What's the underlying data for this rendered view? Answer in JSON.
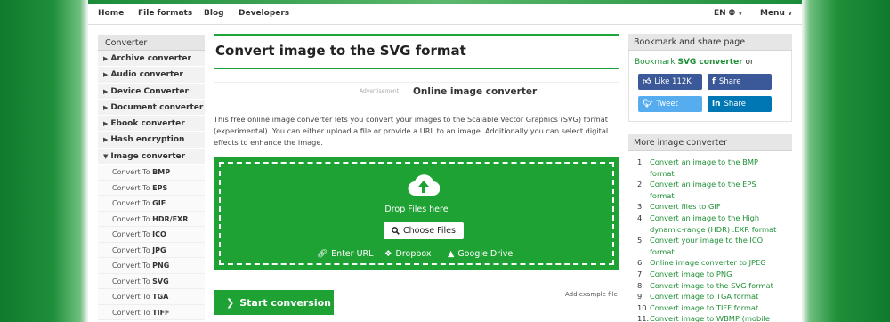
{
  "nav": {
    "home": "Home",
    "file_formats": "File formats",
    "blog": "Blog",
    "developers": "Developers",
    "lang": "EN",
    "menu": "Menu"
  },
  "sidebar": {
    "header": "Converter",
    "categories": [
      "Archive converter",
      "Audio converter",
      "Device Converter",
      "Document converter",
      "Ebook converter",
      "Hash encryption",
      "Image converter"
    ],
    "sub_prefix": "Convert To",
    "sub_items": [
      "BMP",
      "EPS",
      "GIF",
      "HDR/EXR",
      "ICO",
      "JPG",
      "PNG",
      "SVG",
      "TGA",
      "TIFF"
    ]
  },
  "main": {
    "title": "Convert image to the SVG format",
    "ad_label": "Advertisement",
    "section_title": "Online image converter",
    "description": "This free online image converter lets you convert your images to the Scalable Vector Graphics (SVG) format (experimental). You can either upload a file or provide a URL to an image. Additionally you can select digital effects to enhance the image.",
    "drop_text": "Drop Files here",
    "choose_files": "Choose Files",
    "enter_url": "Enter URL",
    "dropbox": "Dropbox",
    "google_drive": "Google Drive",
    "start": "Start conversion",
    "add_example": "Add example file"
  },
  "bookmark": {
    "header": "Bookmark and share page",
    "text_prefix": "Bookmark",
    "text_link": "SVG converter",
    "text_suffix": "or",
    "like": "Like 112K",
    "share_fb": "Share",
    "tweet": "Tweet",
    "share_in": "Share"
  },
  "more": {
    "header": "More image converter",
    "items": [
      {
        "num": "1.",
        "lines": [
          "Convert an image to the BMP",
          "format"
        ]
      },
      {
        "num": "2.",
        "lines": [
          "Convert an image to the EPS",
          "format"
        ]
      },
      {
        "num": "3.",
        "lines": [
          "Convert files to GIF"
        ]
      },
      {
        "num": "4.",
        "lines": [
          "Convert an image to the High",
          "dynamic-range (HDR) .EXR format"
        ]
      },
      {
        "num": "5.",
        "lines": [
          "Convert your image to the ICO",
          "format"
        ]
      },
      {
        "num": "6.",
        "lines": [
          "Online image converter to JPEG"
        ]
      },
      {
        "num": "7.",
        "lines": [
          "Convert image to PNG"
        ]
      },
      {
        "num": "8.",
        "lines": [
          "Convert image to the SVG format"
        ]
      },
      {
        "num": "9.",
        "lines": [
          "Convert image to TGA format"
        ]
      },
      {
        "num": "10.",
        "lines": [
          "Convert image to TIFF format"
        ]
      },
      {
        "num": "11.",
        "lines": [
          "Convert image to WBMP (mobile"
        ]
      }
    ]
  },
  "colors": {
    "accent": "#1ea234",
    "link": "#1d8f35",
    "facebook": "#3b5998",
    "twitter": "#55acee",
    "linkedin": "#0077b5"
  }
}
